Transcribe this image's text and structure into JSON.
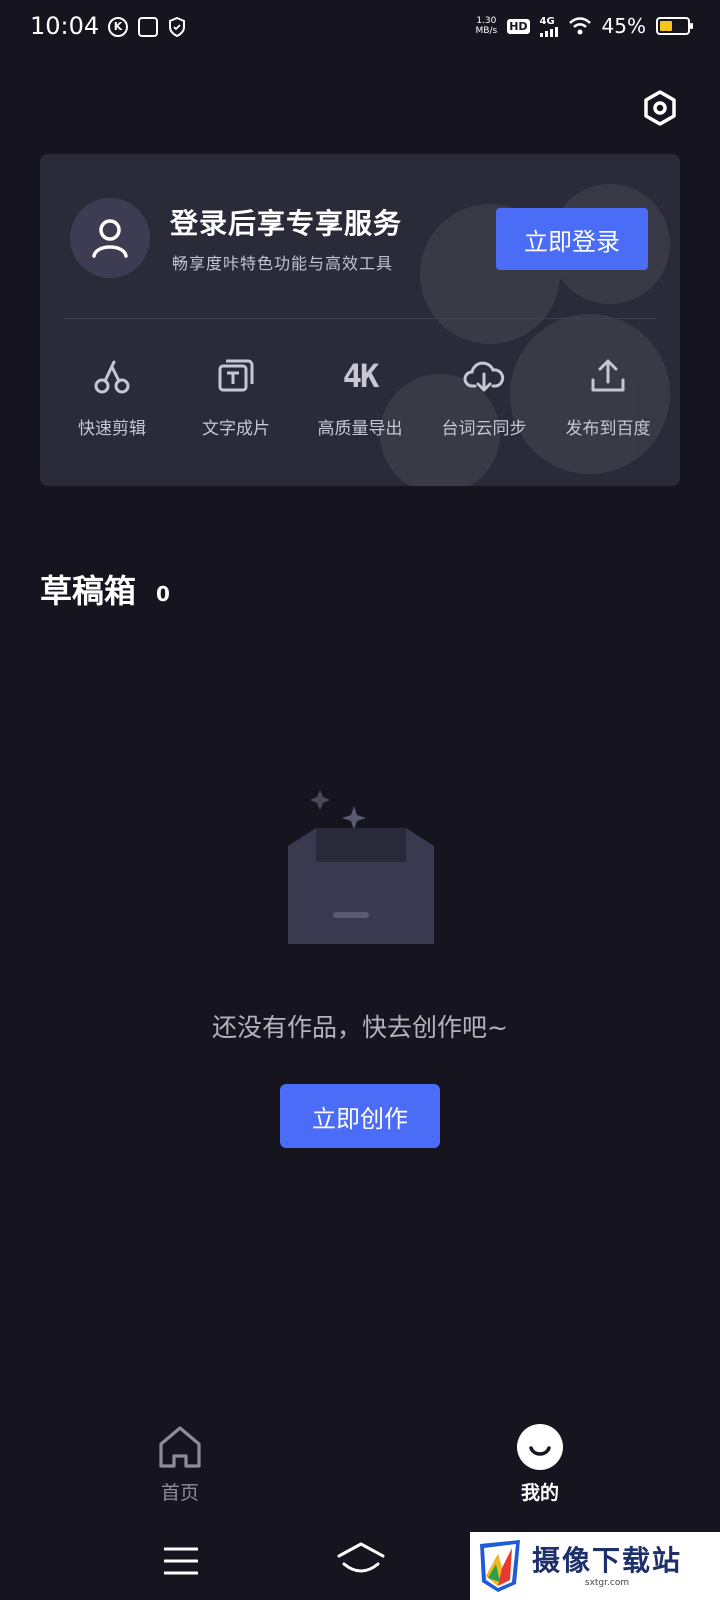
{
  "status_bar": {
    "time": "10:04",
    "net_speed_value": "1.30",
    "net_speed_unit": "MB/s",
    "hd": "HD",
    "network": "4G",
    "battery_text": "45%",
    "battery_level": 0.45
  },
  "profile": {
    "login_title": "登录后享专享服务",
    "login_subtitle": "畅享度咔特色功能与高效工具",
    "login_button": "立即登录",
    "features": [
      {
        "label": "快速剪辑",
        "icon": "scissors-icon"
      },
      {
        "label": "文字成片",
        "icon": "text-to-video-icon"
      },
      {
        "label": "高质量导出",
        "icon": "4k-icon"
      },
      {
        "label": "台词云同步",
        "icon": "cloud-sync-icon"
      },
      {
        "label": "发布到百度",
        "icon": "upload-icon"
      }
    ],
    "feature_4k_glyph": "4K"
  },
  "drafts": {
    "title": "草稿箱",
    "count": "0",
    "empty_text": "还没有作品，快去创作吧~",
    "create_button": "立即创作"
  },
  "tab_bar": {
    "home": "首页",
    "mine": "我的",
    "active": "mine"
  },
  "watermark": {
    "title": "摄像下载站",
    "url": "sxtgr.com"
  },
  "colors": {
    "background": "#16151f",
    "card": "#2b2a38",
    "accent": "#4a6cf7",
    "battery": "#f5c518"
  }
}
